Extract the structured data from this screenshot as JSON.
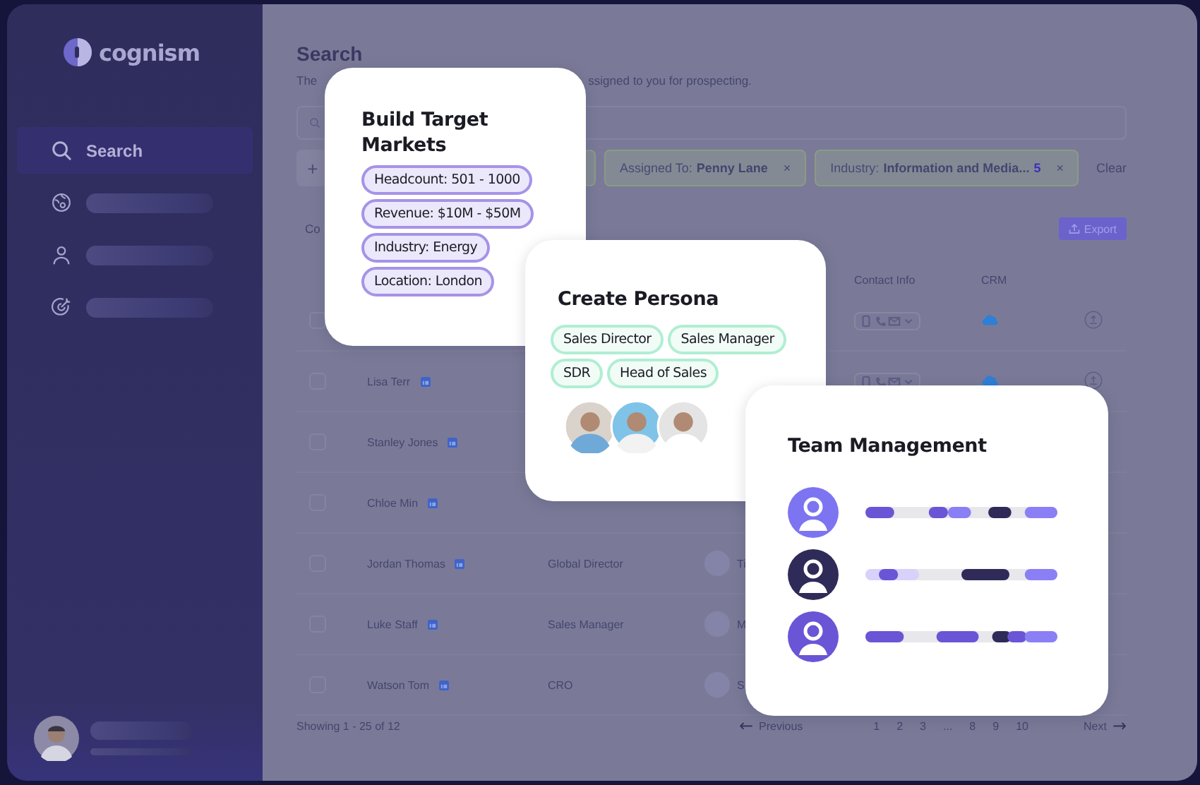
{
  "sidebar": {
    "logo": "cognism",
    "items": [
      {
        "label": "Search",
        "selected": true
      },
      {
        "selected": false
      },
      {
        "selected": false
      },
      {
        "selected": false
      }
    ]
  },
  "main": {
    "title": "Search",
    "subtitle_parts": [
      "The",
      "ssigned to you for prospecting."
    ],
    "add_button": "+",
    "filters": [
      {
        "kind": "hidden"
      },
      {
        "kind": "chip",
        "label": "Assigned To:",
        "value": "Penny Lane",
        "close": "×"
      },
      {
        "kind": "chip",
        "label": "Industry:",
        "value": "Information and Media...",
        "count": "5",
        "close": "×"
      }
    ],
    "clear": "Clear",
    "list_label": "Co",
    "export": "Export",
    "columns": {
      "contact": "Contact Info",
      "crm": "CRM"
    },
    "rows": [
      {
        "checked": false,
        "contact": true,
        "crm": true,
        "export": true
      },
      {
        "checked": false,
        "name": "Lisa Terr",
        "contact": true,
        "crm": true,
        "export": true
      },
      {
        "checked": false,
        "name": "Stanley Jones"
      },
      {
        "checked": false,
        "name": "Chloe Min"
      },
      {
        "checked": false,
        "name": "Jordan Thomas",
        "title": "Global Director",
        "avatar": true,
        "company": "Ti"
      },
      {
        "checked": false,
        "name": "Luke Staff",
        "title": "Sales Manager",
        "avatar": true,
        "company": "M"
      },
      {
        "checked": false,
        "name": "Watson Tom",
        "title": "CRO",
        "avatar": true,
        "company": "S"
      }
    ],
    "showing": "Showing 1 - 25 of 12",
    "previous_arrow": "←",
    "previous": "Previous",
    "next_arrow": "→",
    "pages": [
      "1",
      "2",
      "3",
      "...",
      "8",
      "9",
      "10"
    ],
    "next": "Next"
  },
  "cards": {
    "markets": {
      "title": "Build Target Markets",
      "chips": [
        "Headcount: 501 - 1000",
        "Revenue: $10M - $50M",
        "Industry: Energy",
        "Location: London"
      ]
    },
    "persona": {
      "title": "Create Persona",
      "chips": [
        "Sales Director",
        "Sales Manager",
        "SDR",
        "Head of Sales"
      ]
    },
    "team": {
      "title": "Team Management",
      "members": [
        {
          "color": "#7d74f2"
        },
        {
          "color": "#2e2b58"
        },
        {
          "color": "#6a55d6"
        }
      ]
    }
  }
}
